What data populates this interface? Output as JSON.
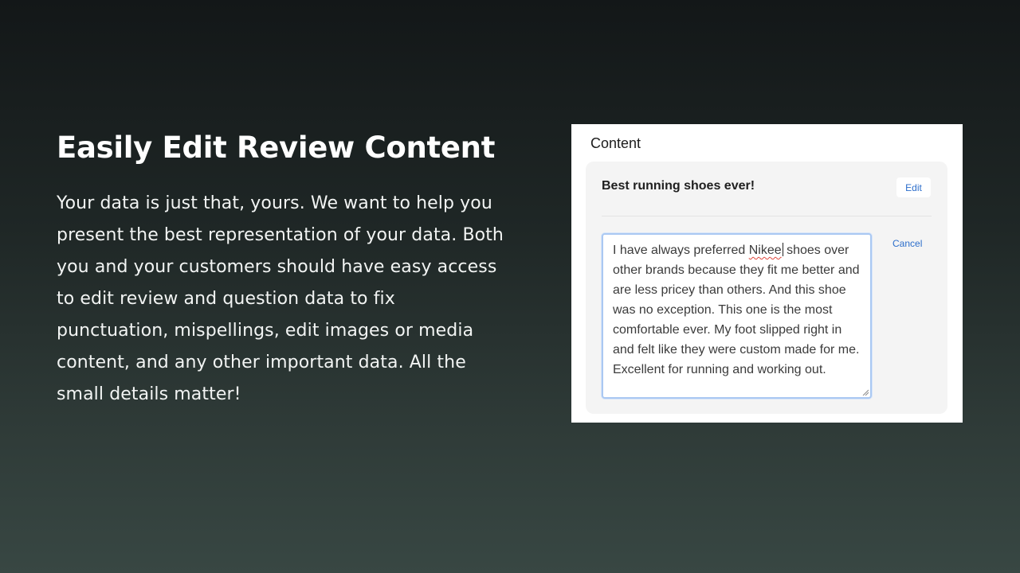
{
  "hero": {
    "headline": "Easily Edit Review Content",
    "description": "Your data is just that, yours. We want to help you present the best representation of your data. Both you and your customers should have easy access to edit review and question data to fix punctuation, mispellings, edit images or media content, and any other important data. All the small details matter!"
  },
  "panel": {
    "title": "Content",
    "review_title": "Best running shoes ever!",
    "edit_label": "Edit",
    "cancel_label": "Cancel",
    "body_before": "I have always preferred ",
    "misspelled_word": "Nikee",
    "body_after": " shoes over other brands because they fit me better and are less pricey than others.  And this shoe was no exception.  This one is the most comfortable ever.  My foot slipped right in and felt like they were custom made for me.  Excellent for running and working out."
  },
  "colors": {
    "link_blue": "#2c6ecb",
    "focus_border": "#aac8f2",
    "spellcheck_red": "#e0453a"
  }
}
